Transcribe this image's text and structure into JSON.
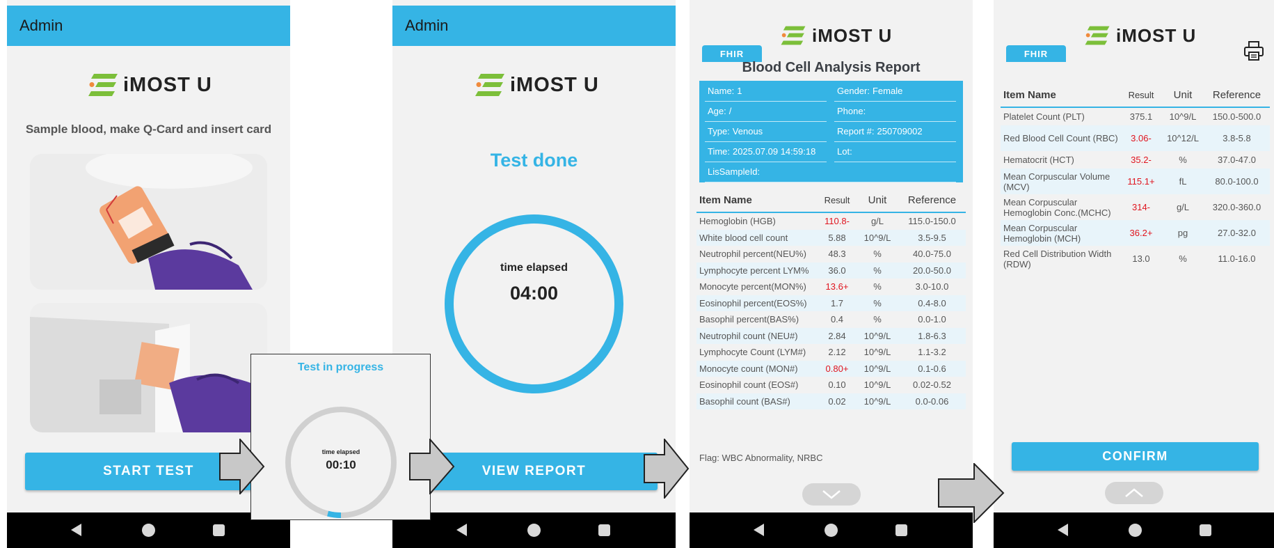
{
  "app": {
    "brand": "iMOST U",
    "header_title": "Admin"
  },
  "screen1": {
    "instruction": "Sample blood, make Q-Card and insert card",
    "start_button": "START TEST"
  },
  "progress_popup": {
    "title": "Test in progress",
    "elapsed_label": "time elapsed",
    "elapsed_value": "00:10",
    "progress_fraction": 0.04
  },
  "screen2": {
    "status": "Test done",
    "elapsed_label": "time elapsed",
    "elapsed_value": "04:00",
    "progress_fraction": 1.0,
    "view_report_button": "VIEW REPORT"
  },
  "report": {
    "fhir_tab": "FHIR",
    "title": "Blood Cell Analysis Report",
    "patient": {
      "name": {
        "label": "Name:",
        "value": "1"
      },
      "gender": {
        "label": "Gender:",
        "value": "Female"
      },
      "age": {
        "label": "Age:",
        "value": "/"
      },
      "phone": {
        "label": "Phone:",
        "value": ""
      },
      "type": {
        "label": "Type:",
        "value": "Venous"
      },
      "report_no": {
        "label": "Report #:",
        "value": "250709002"
      },
      "time": {
        "label": "Time:",
        "value": "2025.07.09 14:59:18"
      },
      "lot": {
        "label": "Lot:",
        "value": ""
      },
      "lis": {
        "label": "LisSampleId:",
        "value": ""
      }
    },
    "columns": {
      "name": "Item Name",
      "result": "Result",
      "unit": "Unit",
      "reference": "Reference"
    },
    "rows": [
      {
        "name": "Hemoglobin (HGB)",
        "result": "110.8-",
        "unit": "g/L",
        "reference": "115.0-150.0",
        "flag": true
      },
      {
        "name": "White blood cell count",
        "result": "5.88",
        "unit": "10^9/L",
        "reference": "3.5-9.5",
        "flag": false
      },
      {
        "name": "Neutrophil percent(NEU%)",
        "result": "48.3",
        "unit": "%",
        "reference": "40.0-75.0",
        "flag": false
      },
      {
        "name": "Lymphocyte percent LYM%",
        "result": "36.0",
        "unit": "%",
        "reference": "20.0-50.0",
        "flag": false
      },
      {
        "name": "Monocyte percent(MON%)",
        "result": "13.6+",
        "unit": "%",
        "reference": "3.0-10.0",
        "flag": true
      },
      {
        "name": "Eosinophil percent(EOS%)",
        "result": "1.7",
        "unit": "%",
        "reference": "0.4-8.0",
        "flag": false
      },
      {
        "name": "Basophil percent(BAS%)",
        "result": "0.4",
        "unit": "%",
        "reference": "0.0-1.0",
        "flag": false
      },
      {
        "name": "Neutrophil count (NEU#)",
        "result": "2.84",
        "unit": "10^9/L",
        "reference": "1.8-6.3",
        "flag": false
      },
      {
        "name": "Lymphocyte Count (LYM#)",
        "result": "2.12",
        "unit": "10^9/L",
        "reference": "1.1-3.2",
        "flag": false
      },
      {
        "name": "Monocyte count (MON#)",
        "result": "0.80+",
        "unit": "10^9/L",
        "reference": "0.1-0.6",
        "flag": true
      },
      {
        "name": "Eosinophil count (EOS#)",
        "result": "0.10",
        "unit": "10^9/L",
        "reference": "0.02-0.52",
        "flag": false
      },
      {
        "name": "Basophil count (BAS#)",
        "result": "0.02",
        "unit": "10^9/L",
        "reference": "0.0-0.06",
        "flag": false
      }
    ],
    "flag_text": "Flag: WBC Abnormality, NRBC"
  },
  "report2": {
    "fhir_tab": "FHIR",
    "rows": [
      {
        "name": "Platelet Count (PLT)",
        "result": "375.1",
        "unit": "10^9/L",
        "reference": "150.0-500.0",
        "flag": false
      },
      {
        "name": "Red Blood Cell Count (RBC)",
        "result": "3.06-",
        "unit": "10^12/L",
        "reference": "3.8-5.8",
        "flag": true
      },
      {
        "name": "Hematocrit (HCT)",
        "result": "35.2-",
        "unit": "%",
        "reference": "37.0-47.0",
        "flag": true
      },
      {
        "name": "Mean Corpuscular Volume (MCV)",
        "result": "115.1+",
        "unit": "fL",
        "reference": "80.0-100.0",
        "flag": true
      },
      {
        "name": "Mean Corpuscular Hemoglobin Conc.(MCHC)",
        "result": "314-",
        "unit": "g/L",
        "reference": "320.0-360.0",
        "flag": true
      },
      {
        "name": "Mean Corpuscular Hemoglobin (MCH)",
        "result": "36.2+",
        "unit": "pg",
        "reference": "27.0-32.0",
        "flag": true
      },
      {
        "name": "Red Cell Distribution Width (RDW)",
        "result": "13.0",
        "unit": "%",
        "reference": "11.0-16.0",
        "flag": false
      }
    ],
    "confirm_button": "CONFIRM"
  },
  "colors": {
    "accent": "#35b4e5",
    "flag_red": "#e0141e",
    "logo_green": "#7cbf3a",
    "logo_orange": "#f08a3c",
    "ring_track": "#d0d0d0"
  },
  "icons": [
    "back-icon",
    "home-icon",
    "recent-apps-icon",
    "chevron-down-icon",
    "chevron-up-icon",
    "printer-icon",
    "arrow-right-icon"
  ]
}
